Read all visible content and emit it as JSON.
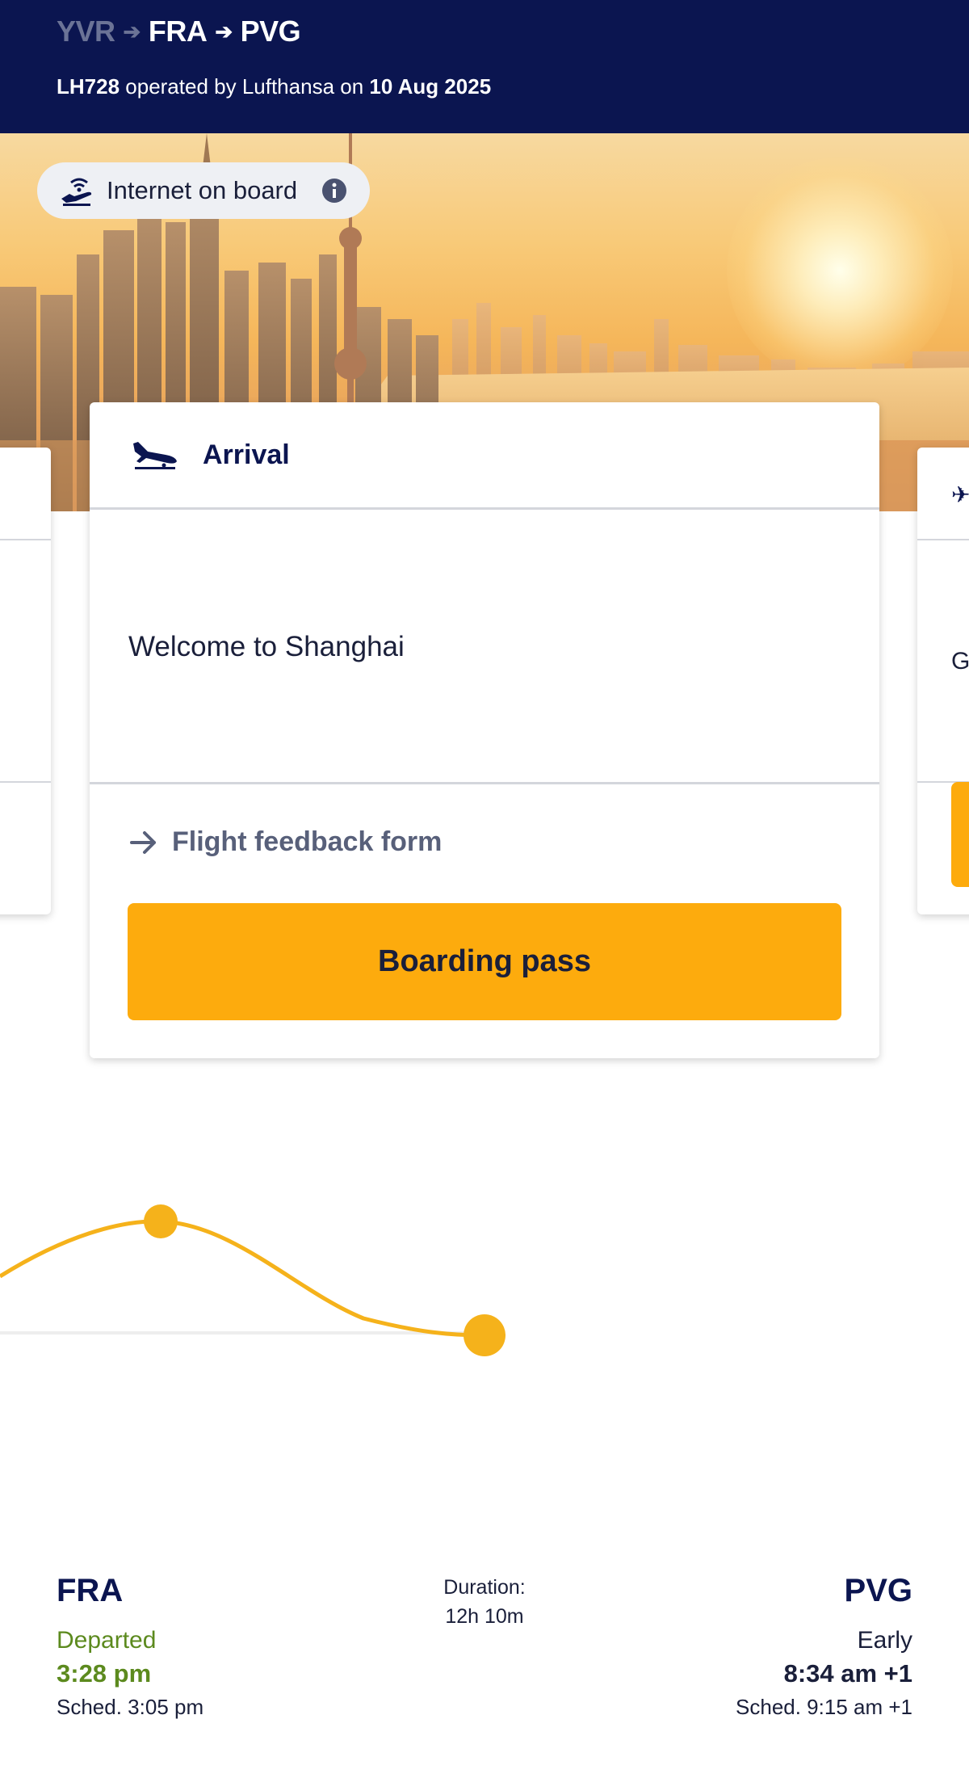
{
  "header": {
    "route": {
      "origin": "YVR",
      "via": "FRA",
      "destination": "PVG"
    },
    "flight_number": "LH728",
    "operated_text": " operated by Lufthansa on ",
    "date": "10 Aug 2025"
  },
  "hero": {
    "wifi_label": "Internet on board"
  },
  "card": {
    "title": "Arrival",
    "welcome": "Welcome to Shanghai",
    "feedback_link": "Flight feedback form",
    "boarding_pass_button": "Boarding pass"
  },
  "side_card_right": {
    "peek_text": "G"
  },
  "summary": {
    "origin": {
      "code": "FRA",
      "status": "Departed",
      "time": "3:28 pm",
      "scheduled": "Sched. 3:05 pm"
    },
    "duration_label": "Duration:",
    "duration_value": "12h 10m",
    "destination": {
      "code": "PVG",
      "status": "Early",
      "time": "8:34 am +1",
      "scheduled": "Sched. 9:15 am +1"
    }
  },
  "colors": {
    "header_bg": "#0b1550",
    "accent": "#fdab0d",
    "departed_green": "#5c8a1e"
  }
}
